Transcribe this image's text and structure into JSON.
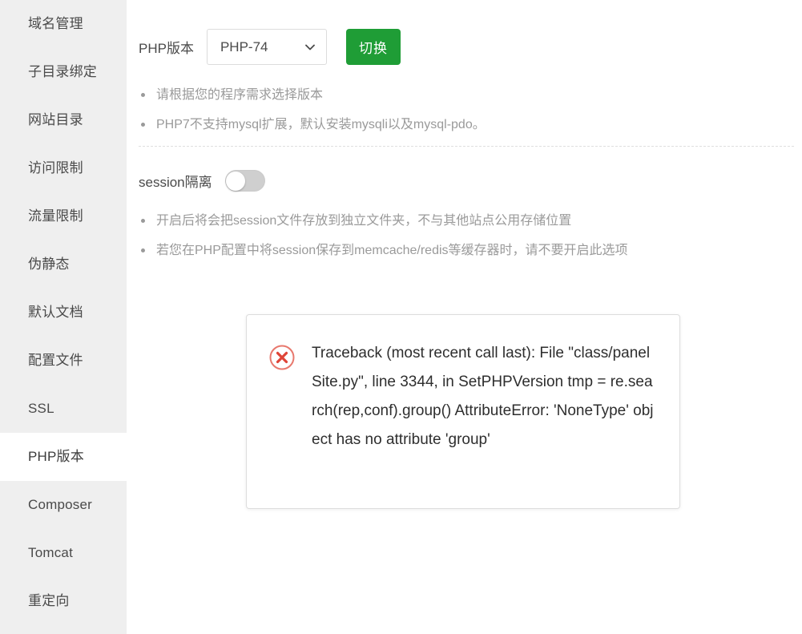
{
  "sidebar": {
    "items": [
      {
        "label": "域名管理",
        "active": false
      },
      {
        "label": "子目录绑定",
        "active": false
      },
      {
        "label": "网站目录",
        "active": false
      },
      {
        "label": "访问限制",
        "active": false
      },
      {
        "label": "流量限制",
        "active": false
      },
      {
        "label": "伪静态",
        "active": false
      },
      {
        "label": "默认文档",
        "active": false
      },
      {
        "label": "配置文件",
        "active": false
      },
      {
        "label": "SSL",
        "active": false
      },
      {
        "label": "PHP版本",
        "active": true
      },
      {
        "label": "Composer",
        "active": false
      },
      {
        "label": "Tomcat",
        "active": false
      },
      {
        "label": "重定向",
        "active": false
      }
    ]
  },
  "php_section": {
    "label": "PHP版本",
    "selected_version": "PHP-74",
    "options": [
      "PHP-74"
    ],
    "switch_button_label": "切换",
    "chevron_icon": "chevron-down-icon",
    "hints": [
      "请根据您的程序需求选择版本",
      "PHP7不支持mysql扩展，默认安装mysqli以及mysql-pdo。"
    ]
  },
  "session_section": {
    "label": "session隔离",
    "toggle_state": "off",
    "hints": [
      "开启后将会把session文件存放到独立文件夹，不与其他站点公用存储位置",
      "若您在PHP配置中将session保存到memcache/redis等缓存器时，请不要开启此选项"
    ]
  },
  "error_dialog": {
    "icon": "error-circle-x-icon",
    "icon_color": "#e04a3f",
    "message": "Traceback (most recent call last): File \"class/panelSite.py\", line 3344, in SetPHPVersion tmp = re.search(rep,conf).group() AttributeError: 'NoneType' object has no attribute 'group'"
  },
  "colors": {
    "sidebar_bg": "#efefef",
    "sidebar_active_bg": "#ffffff",
    "accent_green": "#1f9d36",
    "hint_text": "#9a9a9a",
    "body_text": "#4a4a4a",
    "error_red": "#e04a3f"
  }
}
